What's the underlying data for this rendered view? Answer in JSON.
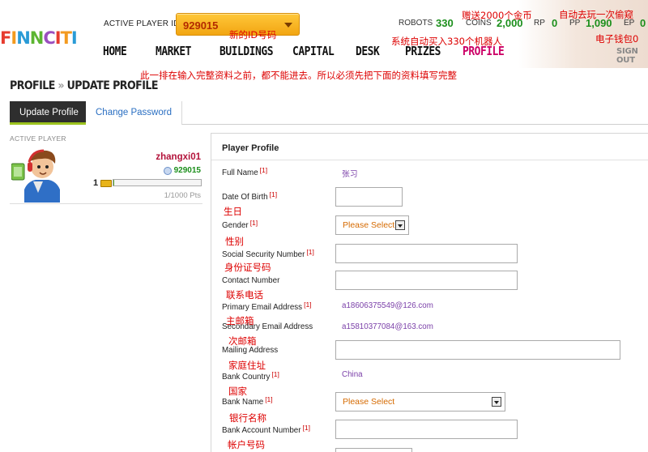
{
  "header": {
    "logo_letters": [
      "F",
      "I",
      "N",
      "N",
      "C",
      "I",
      "T",
      "I"
    ],
    "player_id_label": "ACTIVE PLAYER ID",
    "player_id_value": "929015",
    "stats": {
      "robots_label": "ROBOTS",
      "robots_value": "330",
      "coins_label": "COINS",
      "coins_value": "2,000",
      "rp_label": "RP",
      "rp_value": "0",
      "pp_label": "PP",
      "pp_value": "1,090",
      "ep_label": "EP",
      "ep_value": "0"
    },
    "nav": [
      "HOME",
      "MARKET",
      "BUILDINGS",
      "CAPITAL",
      "DESK",
      "PRIZES",
      "PROFILE"
    ],
    "active_nav": "PROFILE",
    "sign_out": "SIGN OUT"
  },
  "breadcrumb": {
    "parent": "PROFILE",
    "separator": "»",
    "current": "UPDATE PROFILE"
  },
  "tabs": {
    "update": "Update Profile",
    "password": "Change Password"
  },
  "left_panel": {
    "active_player_label": "ACTIVE PLAYER",
    "username": "zhangxi01",
    "player_id": "929015",
    "level": "1",
    "points": "1/1000 Pts",
    "progress_fraction": 0.001
  },
  "form": {
    "title": "Player Profile",
    "required_marker": "[1]",
    "full_name_label": "Full Name",
    "full_name_value": "张习",
    "dob_label": "Date Of Birth",
    "gender_label": "Gender",
    "gender_select": "Please Select",
    "ssn_label": "Social Security Number",
    "contact_label": "Contact Number",
    "primary_email_label": "Primary Email Address",
    "primary_email_value": "a18606375549@126.com",
    "secondary_email_label": "Secondary Email Address",
    "secondary_email_value": "a15810377084@163.com",
    "mailing_label": "Mailing Address",
    "country_label": "Bank Country",
    "country_value": "China",
    "bank_name_label": "Bank Name",
    "bank_name_select": "Please Select",
    "bank_account_label": "Bank Account Number"
  },
  "annotations": {
    "new_id": "新的ID号码",
    "bonus_coins": "赠送2000个金币",
    "auto_steal": "自动去玩一次偷窥",
    "robots_bought": "系统自动买入330个机器人",
    "wallet": "电子钱包0",
    "instruction": "此一排在输入完整资料之前，都不能进去。所以必须先把下面的资料填写完整",
    "birthday": "生日",
    "gender": "性别",
    "id_number": "身份证号码",
    "phone": "联系电话",
    "primary_email": "主邮箱",
    "secondary_email": "次邮箱",
    "home_address": "家庭住址",
    "country": "国家",
    "bank_name": "银行名称",
    "account_number": "帐户号码"
  },
  "colors": {
    "accent": "#cc0066",
    "gold": "#f2a512",
    "green": "#1c8f1c",
    "tab_active": "#2e2e2e",
    "tab_underline": "#9cc31e",
    "annotation": "#dd0000"
  }
}
